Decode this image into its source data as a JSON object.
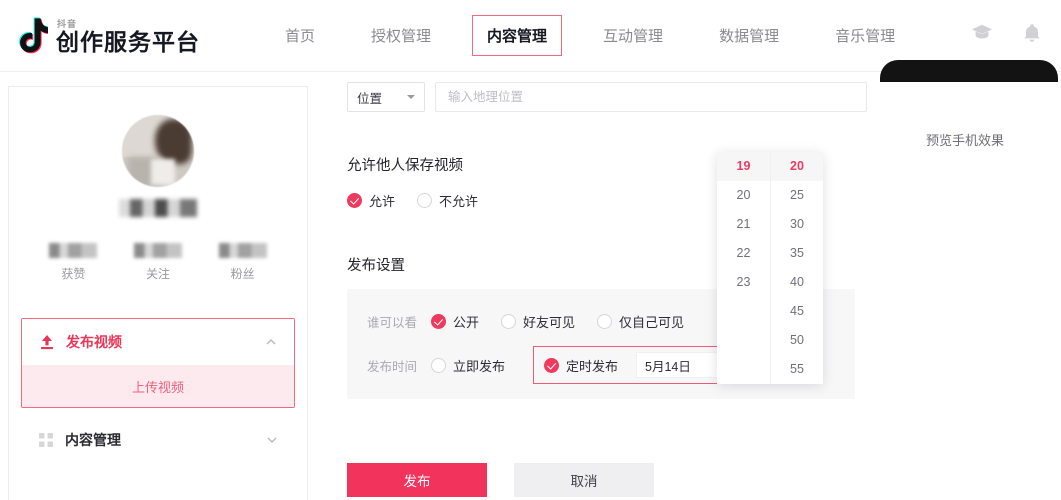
{
  "header": {
    "logo": {
      "sub": "抖音",
      "main": "创作服务平台",
      "icon": "music-note-icon"
    },
    "nav": [
      {
        "label": "首页",
        "active": false
      },
      {
        "label": "授权管理",
        "active": false
      },
      {
        "label": "内容管理",
        "active": true
      },
      {
        "label": "互动管理",
        "active": false
      },
      {
        "label": "数据管理",
        "active": false
      },
      {
        "label": "音乐管理",
        "active": false
      }
    ],
    "icons": [
      {
        "name": "graduation-cap-icon"
      },
      {
        "name": "bell-icon"
      }
    ]
  },
  "sidebar": {
    "profile": {
      "avatar": "user-avatar",
      "username_masked": true
    },
    "stats": [
      {
        "label": "获赞",
        "value_masked": true
      },
      {
        "label": "关注",
        "value_masked": true
      },
      {
        "label": "粉丝",
        "value_masked": true
      }
    ],
    "menu": {
      "publish": {
        "label": "发布视频",
        "icon": "upload-icon",
        "chevron": "chevron-up-icon",
        "expanded": true,
        "highlighted": true,
        "children": [
          {
            "label": "上传视频",
            "active": true
          }
        ]
      },
      "content": {
        "label": "内容管理",
        "icon": "grid-icon",
        "chevron": "chevron-down-icon",
        "expanded": false
      }
    }
  },
  "form": {
    "location": {
      "select_value": "位置",
      "select_icon": "caret-down-icon",
      "input_placeholder": "输入地理位置",
      "input_value": ""
    },
    "save_video": {
      "title": "允许他人保存视频",
      "options": [
        {
          "label": "允许",
          "selected": true
        },
        {
          "label": "不允许",
          "selected": false
        }
      ]
    },
    "publish_settings": {
      "title": "发布设置",
      "visibility": {
        "label": "谁可以看",
        "options": [
          {
            "label": "公开",
            "selected": true
          },
          {
            "label": "好友可见",
            "selected": false
          },
          {
            "label": "仅自己可见",
            "selected": false
          }
        ]
      },
      "timing": {
        "label": "发布时间",
        "options": [
          {
            "label": "立即发布",
            "selected": false
          },
          {
            "label": "定时发布",
            "selected": true
          }
        ],
        "date_value": "5月14日",
        "date_icon": "calendar-icon",
        "highlighted": true
      }
    },
    "actions": {
      "submit": "发布",
      "cancel": "取消"
    }
  },
  "time_picker": {
    "hours": [
      {
        "value": "19",
        "selected": true
      },
      {
        "value": "20",
        "selected": false
      },
      {
        "value": "21",
        "selected": false
      },
      {
        "value": "22",
        "selected": false
      },
      {
        "value": "23",
        "selected": false
      }
    ],
    "minutes": [
      {
        "value": "20",
        "selected": true
      },
      {
        "value": "25",
        "selected": false
      },
      {
        "value": "30",
        "selected": false
      },
      {
        "value": "35",
        "selected": false
      },
      {
        "value": "40",
        "selected": false
      },
      {
        "value": "45",
        "selected": false
      },
      {
        "value": "50",
        "selected": false
      },
      {
        "value": "55",
        "selected": false
      }
    ]
  },
  "preview": {
    "label": "预览手机效果"
  },
  "colors": {
    "accent": "#ef3a5d",
    "accent_soft": "#f26a7e",
    "sub_bg": "#fdeaee",
    "panel_bg": "#f7f7f8",
    "text": "#161823",
    "muted": "#9a9a9e"
  }
}
